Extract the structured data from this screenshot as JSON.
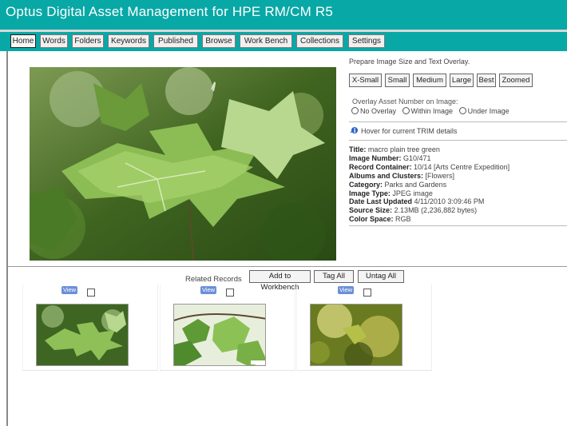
{
  "app": {
    "title": "Optus Digital Asset Management for HPE RM/CM R5"
  },
  "nav": {
    "items": [
      {
        "label": "Home",
        "active": true
      },
      {
        "label": "Words",
        "active": false
      },
      {
        "label": "Folders",
        "active": false
      },
      {
        "label": "Keywords",
        "active": false
      },
      {
        "label": "Published",
        "active": false
      },
      {
        "label": "Browse",
        "active": false
      },
      {
        "label": "Work Bench",
        "active": false
      },
      {
        "label": "Collections",
        "active": false
      },
      {
        "label": "Settings",
        "active": false
      }
    ]
  },
  "panel": {
    "heading": "Prepare Image Size and Text Overlay.",
    "sizes": [
      "X-Small",
      "Small",
      "Medium",
      "Large",
      "Best",
      "Zoomed"
    ],
    "overlay_label": "Overlay Asset Number on Image:",
    "overlay_options": [
      "No Overlay",
      "Within Image",
      "Under Image"
    ],
    "hover_text": "Hover for current TRIM details"
  },
  "details": {
    "title_label": "Title:",
    "title_value": "macro plain tree green",
    "image_number_label": "Image Number:",
    "image_number_value": "G10/471",
    "record_container_label": "Record Container:",
    "record_container_value": "10/14 [Arts Centre Expedition]",
    "albums_label": "Albums and Clusters:",
    "albums_value": "[Flowers]",
    "category_label": "Category:",
    "category_value": "Parks and Gardens",
    "image_type_label": "Image Type:",
    "image_type_value": "JPEG image",
    "date_label": "Date Last Updated",
    "date_value": "4/11/2010 3:09:46 PM",
    "source_size_label": "Source Size:",
    "source_size_value": "2.13MB (2,236,882 bytes)",
    "color_space_label": "Color Space:",
    "color_space_value": "RGB"
  },
  "related": {
    "label": "Related Records",
    "add_to_workbench": "Add to Workbench",
    "tag_all": "Tag All",
    "untag_all": "Untag All",
    "view_label": "View"
  },
  "colors": {
    "header": "#08a8a6",
    "view_button": "#6b8fd9"
  }
}
